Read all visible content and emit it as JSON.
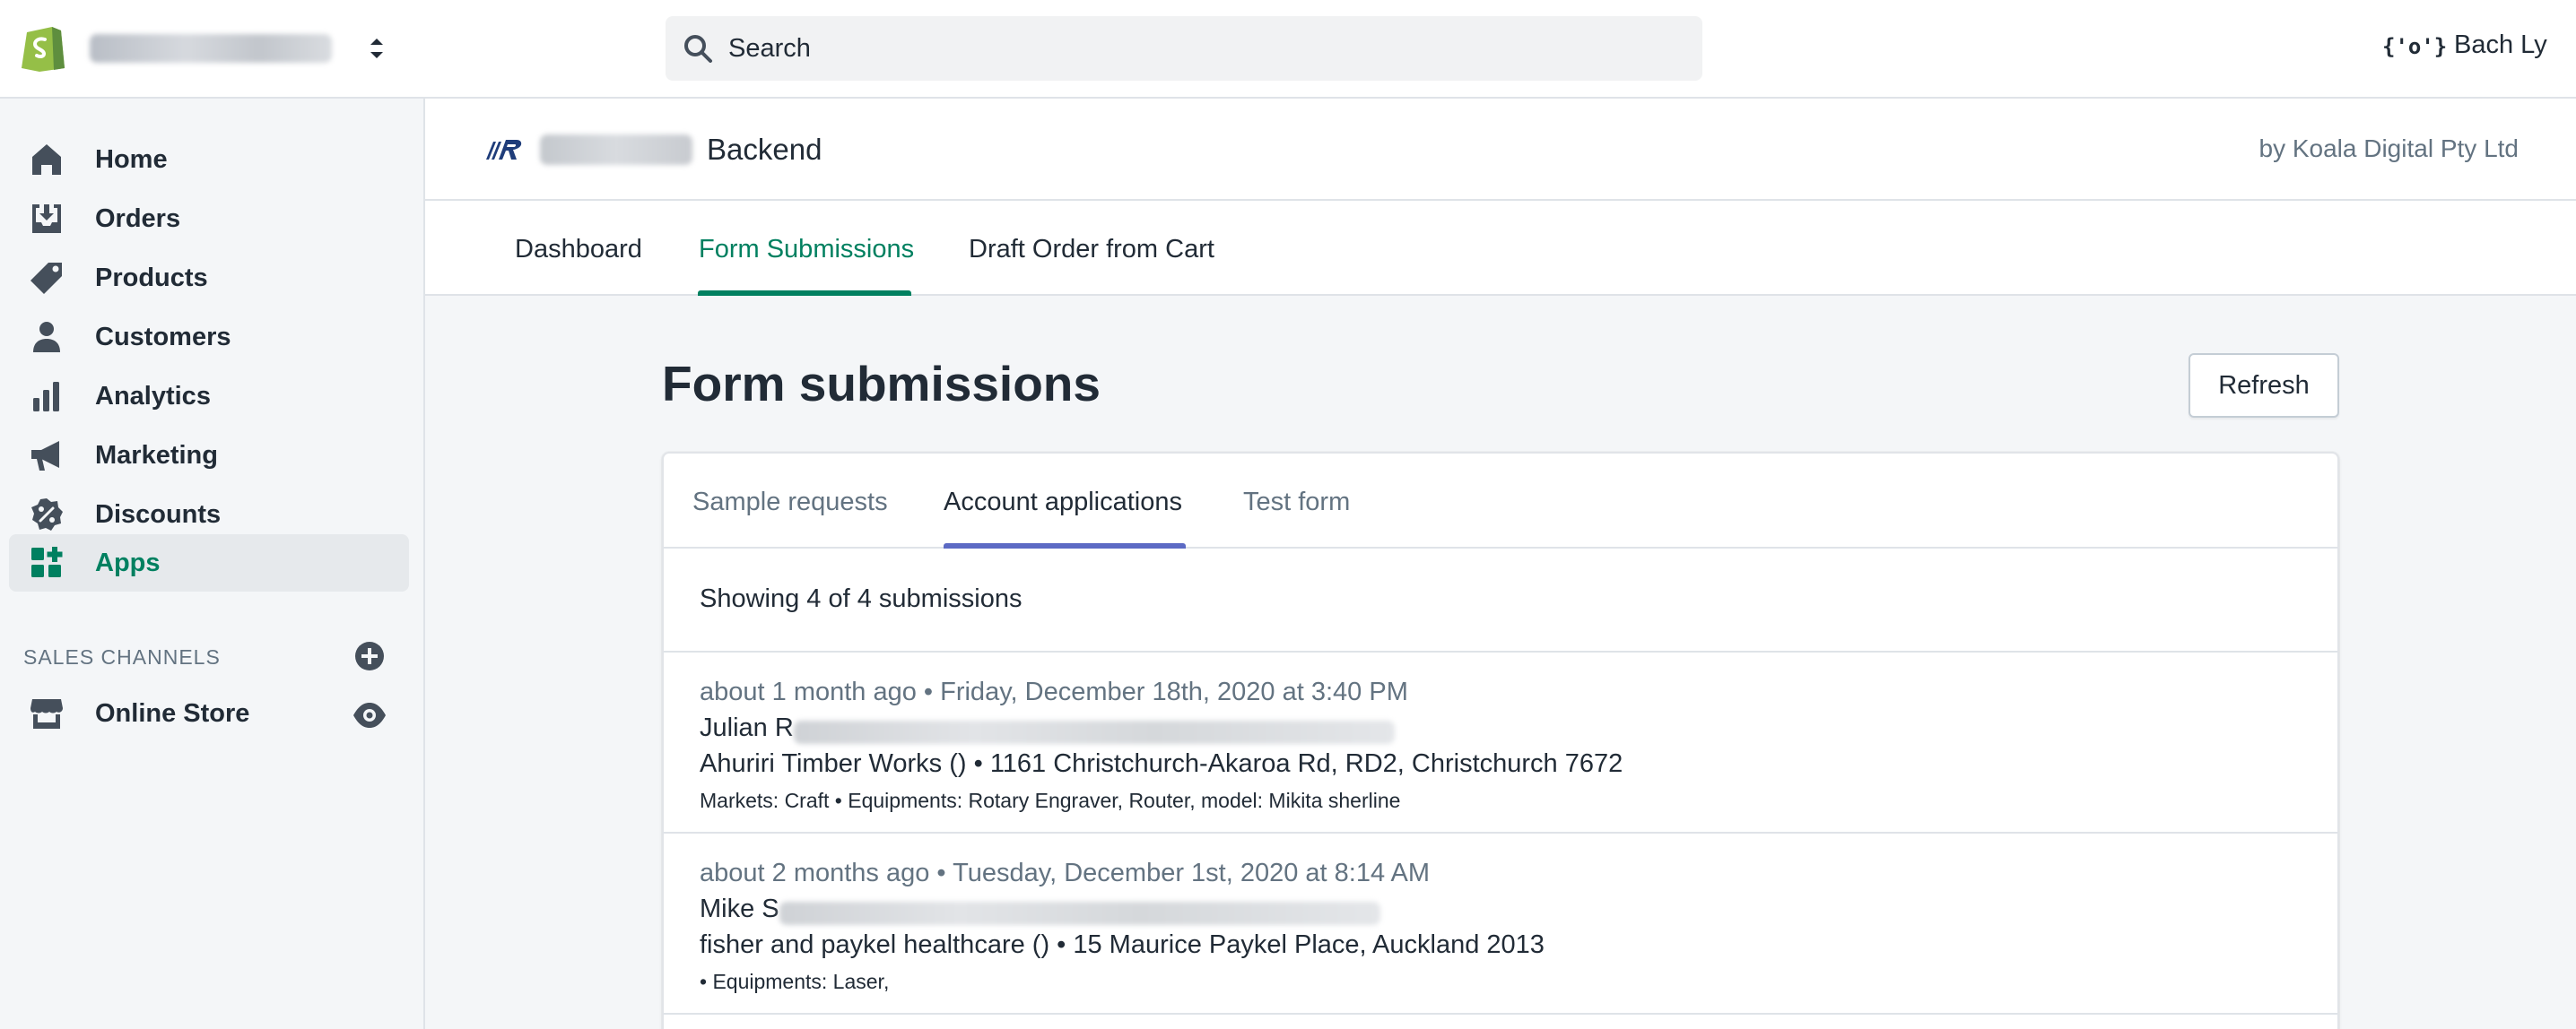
{
  "topbar": {
    "search_placeholder": "Search",
    "user_icon_text": "{'o'}",
    "user_name": "Bach Ly",
    "brand_color": "#95bf47"
  },
  "sidebar": {
    "items": [
      {
        "label": "Home",
        "icon": "home-icon"
      },
      {
        "label": "Orders",
        "icon": "orders-icon"
      },
      {
        "label": "Products",
        "icon": "tag-icon"
      },
      {
        "label": "Customers",
        "icon": "person-icon"
      },
      {
        "label": "Analytics",
        "icon": "bar-chart-icon"
      },
      {
        "label": "Marketing",
        "icon": "megaphone-icon"
      },
      {
        "label": "Discounts",
        "icon": "discount-icon"
      },
      {
        "label": "Apps",
        "icon": "apps-icon",
        "active": true
      }
    ],
    "sales_channels_title": "SALES CHANNELS",
    "channels": [
      {
        "label": "Online Store",
        "icon": "store-icon"
      }
    ],
    "active_color": "#008060"
  },
  "app": {
    "title": "Backend",
    "by": "by Koala Digital Pty Ltd",
    "tabs": [
      {
        "label": "Dashboard"
      },
      {
        "label": "Form Submissions",
        "active": true
      },
      {
        "label": "Draft Order from Cart"
      }
    ]
  },
  "page": {
    "title": "Form submissions",
    "refresh_label": "Refresh"
  },
  "card": {
    "tabs": [
      {
        "label": "Sample requests"
      },
      {
        "label": "Account applications",
        "active": true
      },
      {
        "label": "Test form"
      }
    ],
    "showing": "Showing 4 of 4 submissions",
    "submissions": [
      {
        "meta": "about 1 month ago • Friday, December 18th, 2020 at 3:40 PM",
        "name": "Julian R",
        "address": "Ahuriri Timber Works () • 1161 Christchurch-Akaroa Rd, RD2, Christchurch 7672",
        "details": "Markets: Craft • Equipments: Rotary Engraver, Router, model: Mikita sherline"
      },
      {
        "meta": "about 2 months ago • Tuesday, December 1st, 2020 at 8:14 AM",
        "name": "Mike S",
        "address": "fisher and paykel healthcare () • 15 Maurice Paykel Place, Auckland 2013",
        "details": "• Equipments: Laser,"
      }
    ],
    "accent_color": "#5c6ac4"
  }
}
